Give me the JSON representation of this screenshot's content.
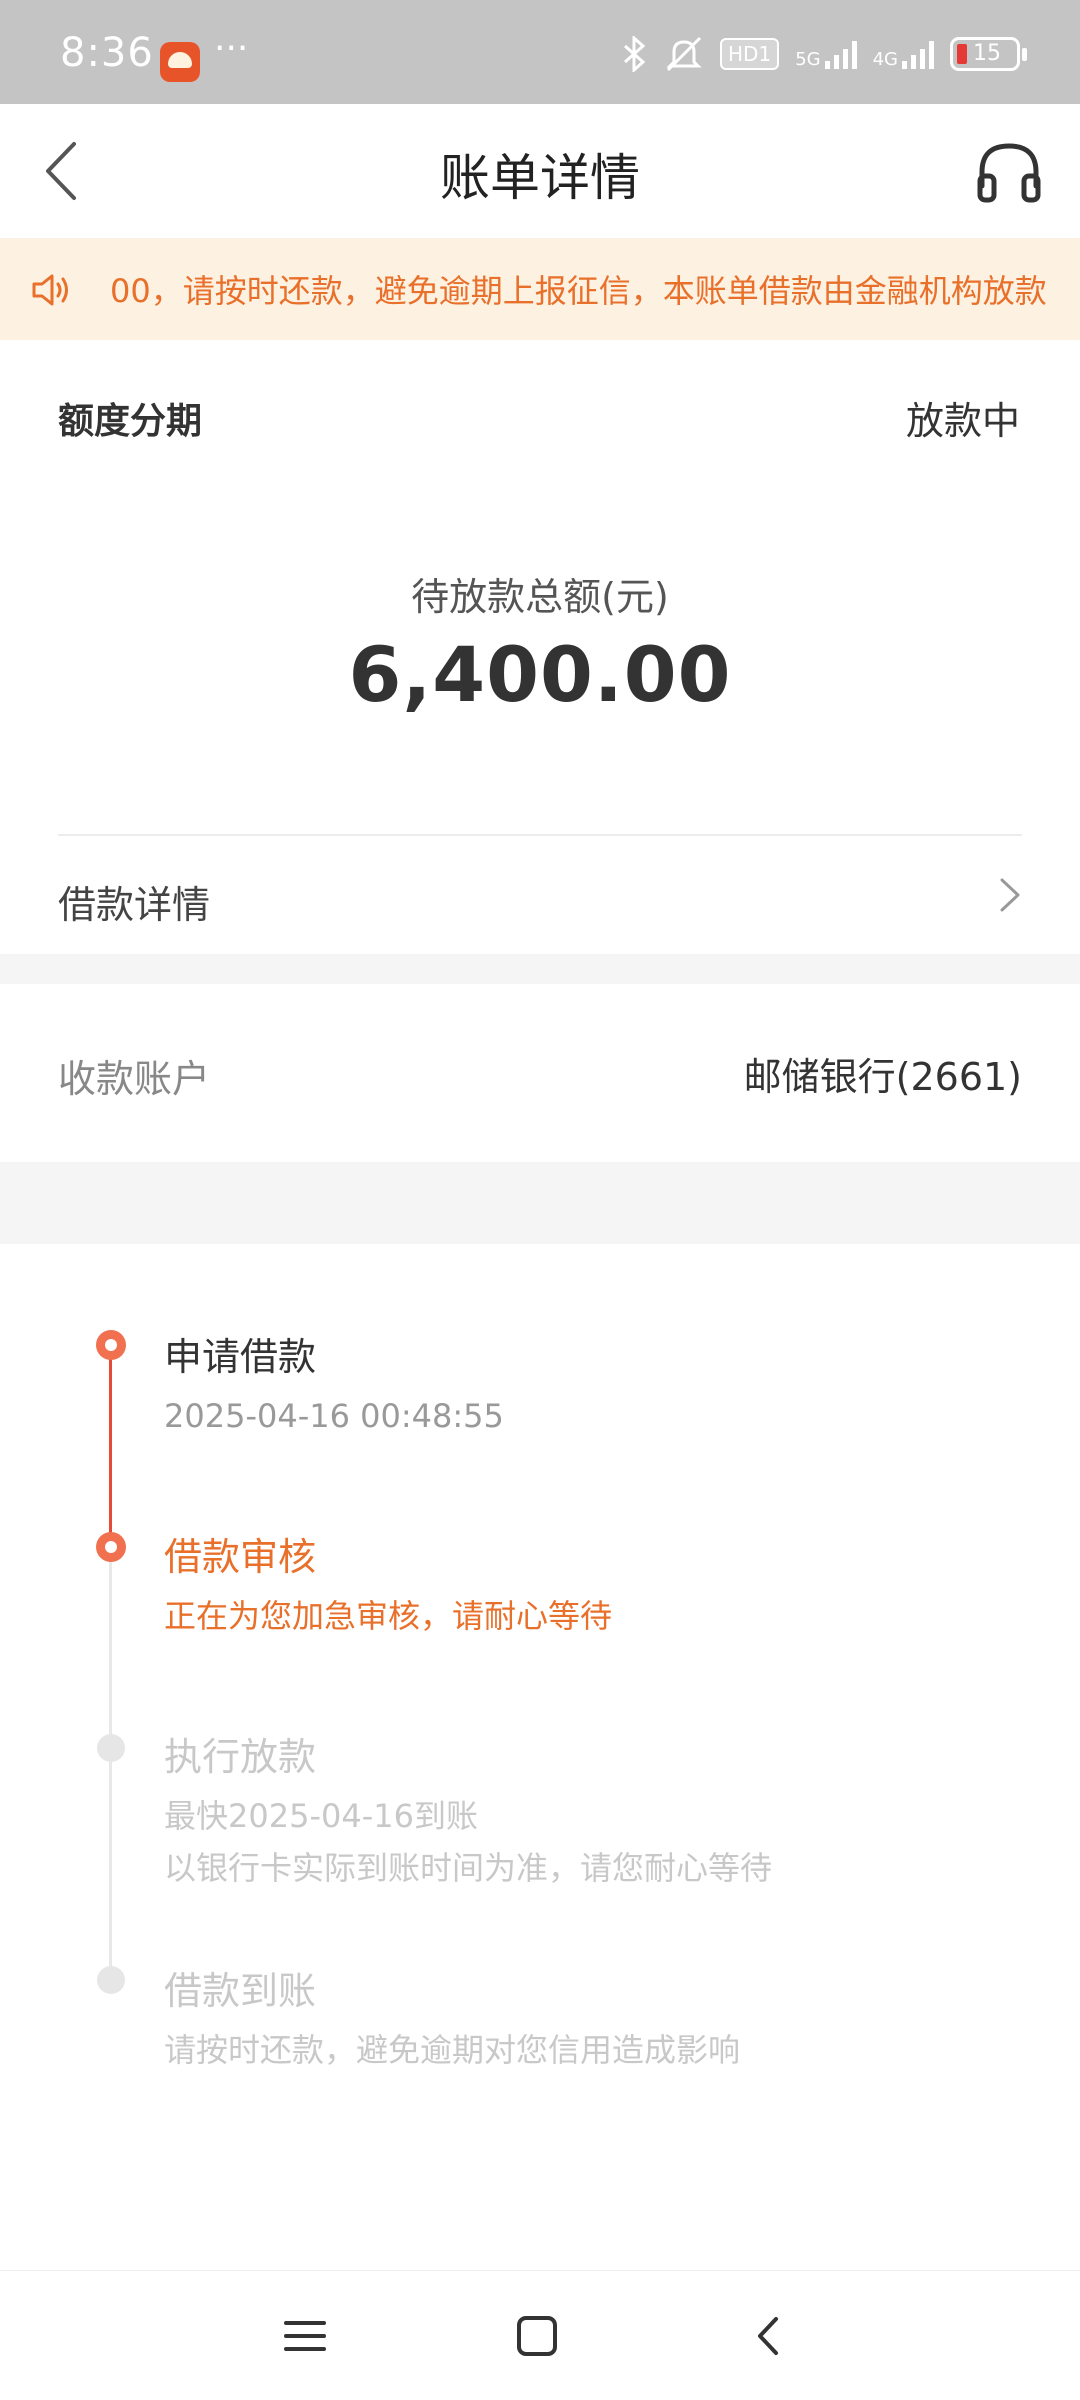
{
  "status_bar": {
    "time": "8:36",
    "dots": "···",
    "hd_label": "HD1",
    "net1_label": "5G",
    "net2_label": "4G",
    "battery_level": "15"
  },
  "nav": {
    "title": "账单详情"
  },
  "notice": {
    "text": "00，请按时还款，避免逾期上报征信，本账单借款由金融机构放款"
  },
  "summary": {
    "type": "额度分期",
    "status": "放款中",
    "amount_label": "待放款总额(元)",
    "amount": "6,400.00",
    "loan_details_label": "借款详情"
  },
  "account": {
    "label": "收款账户",
    "value": "邮储银行(2661)"
  },
  "timeline": {
    "steps": [
      {
        "title": "申请借款",
        "line1": "2025-04-16 00:48:55"
      },
      {
        "title": "借款审核",
        "line1": "正在为您加急审核，请耐心等待"
      },
      {
        "title": "执行放款",
        "line1": "最快2025-04-16到账",
        "line2": "以银行卡实际到账时间为准，请您耐心等待"
      },
      {
        "title": "借款到账",
        "line1": "请按时还款，避免逾期对您信用造成影响"
      }
    ]
  },
  "colors": {
    "accent": "#e8702a",
    "done_dot": "#f07050",
    "pending": "#cccccc",
    "notice_bg": "#fdf1e2"
  }
}
